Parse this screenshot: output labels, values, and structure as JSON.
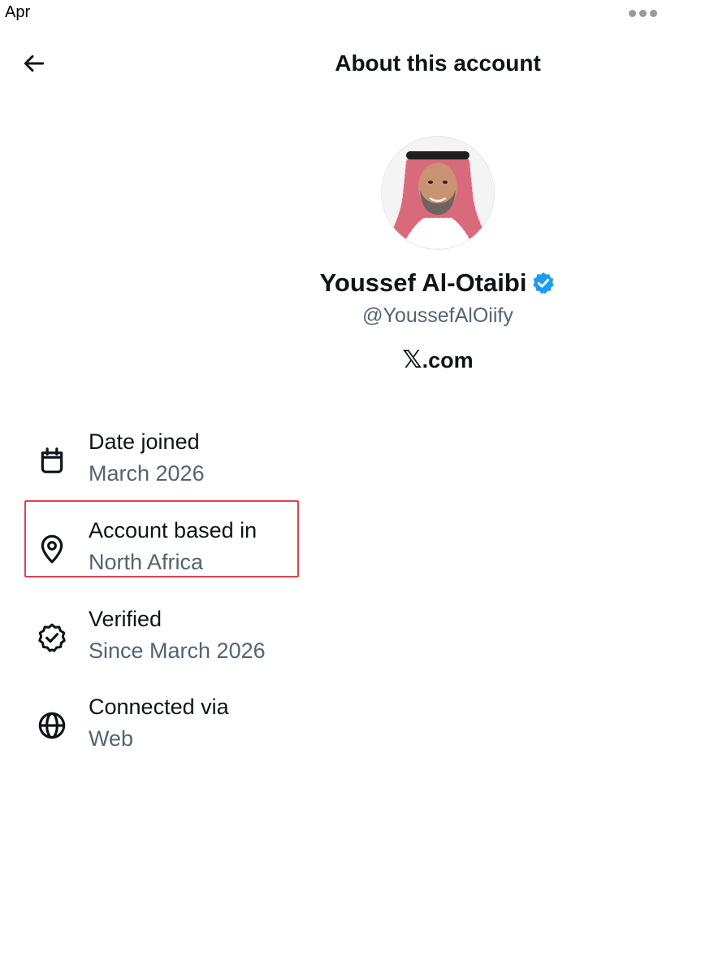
{
  "status_bar": {
    "time": "Apr"
  },
  "header": {
    "title": "About this account"
  },
  "profile": {
    "name": "Youssef Al-Otaibi",
    "handle": "@YoussefAlOiify",
    "platform_logo": "𝕏",
    "platform_domain": ".com",
    "badge_color": "#1d9bf0"
  },
  "info": {
    "date_joined": {
      "title": "Date joined",
      "value": "March 2026",
      "icon": "calendar-icon"
    },
    "location": {
      "title": "Account based in",
      "value": "North Africa",
      "icon": "location-pin-icon"
    },
    "verified": {
      "title": "Verified",
      "value": "Since March 2026",
      "icon": "verified-badge-icon"
    },
    "connected": {
      "title": "Connected via",
      "value": "Web",
      "icon": "globe-icon"
    }
  },
  "highlight_color": "#e0424f"
}
